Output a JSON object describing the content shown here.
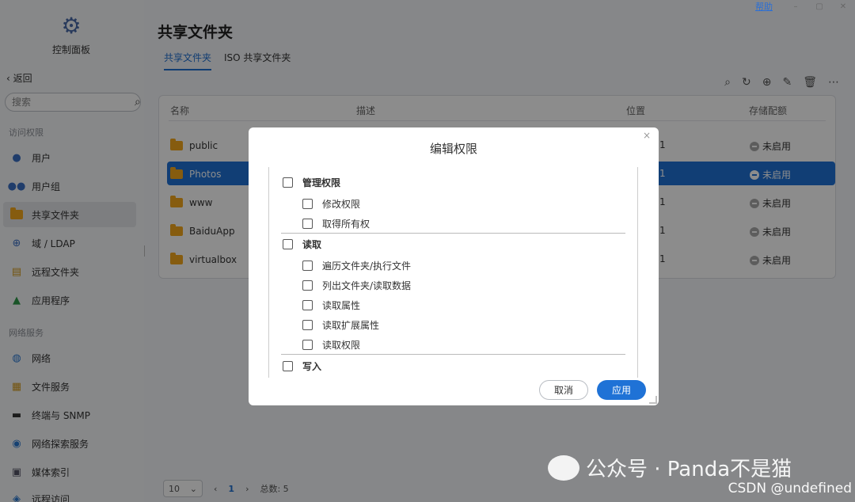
{
  "window": {
    "help": "帮助",
    "minimize": "–",
    "maximize": "▢",
    "close": "✕"
  },
  "sidebar": {
    "control_panel": "控制面板",
    "back": "返回",
    "search_placeholder": "搜索",
    "sections": [
      {
        "title": "访问权限"
      },
      {
        "title": "网络服务"
      }
    ],
    "items": [
      {
        "label": "用户",
        "icon": "user-icon"
      },
      {
        "label": "用户组",
        "icon": "user-group-icon"
      },
      {
        "label": "共享文件夹",
        "icon": "folder-icon",
        "active": true
      },
      {
        "label": "域 / LDAP",
        "icon": "domain-icon"
      },
      {
        "label": "远程文件夹",
        "icon": "remote-folder-icon"
      },
      {
        "label": "应用程序",
        "icon": "app-icon"
      },
      {
        "label": "网络",
        "icon": "network-icon"
      },
      {
        "label": "文件服务",
        "icon": "file-service-icon"
      },
      {
        "label": "终端与 SNMP",
        "icon": "terminal-icon"
      },
      {
        "label": "网络探索服务",
        "icon": "discovery-icon"
      },
      {
        "label": "媒体索引",
        "icon": "media-index-icon"
      },
      {
        "label": "远程访问",
        "icon": "remote-access-icon"
      }
    ]
  },
  "main": {
    "title": "共享文件夹",
    "tabs": [
      {
        "label": "共享文件夹",
        "active": true
      },
      {
        "label": "ISO 共享文件夹",
        "active": false
      }
    ],
    "table": {
      "headers": [
        "名称",
        "描述",
        "位置",
        "存储配额"
      ],
      "rows": [
        {
          "name": "public",
          "location": "1",
          "quota": "未启用"
        },
        {
          "name": "Photos",
          "location": "1",
          "quota": "未启用",
          "selected": true
        },
        {
          "name": "www",
          "location": "1",
          "quota": "未启用"
        },
        {
          "name": "BaiduApp",
          "location": "1",
          "quota": "未启用"
        },
        {
          "name": "virtualbox",
          "location": "1",
          "quota": "未启用"
        }
      ]
    },
    "pager": {
      "page_size": "10",
      "current": "1",
      "total": "总数: 5"
    }
  },
  "dialog": {
    "title": "编辑权限",
    "groups": [
      {
        "label": "管理权限",
        "items": [
          "修改权限",
          "取得所有权"
        ]
      },
      {
        "label": "读取",
        "items": [
          "遍历文件夹/执行文件",
          "列出文件夹/读取数据",
          "读取属性",
          "读取扩展属性",
          "读取权限"
        ]
      },
      {
        "label": "写入",
        "items": []
      }
    ],
    "cancel": "取消",
    "apply": "应用"
  },
  "watermark": {
    "wechat": "公众号 · Panda不是猫",
    "csdn": "CSDN @undefined"
  }
}
